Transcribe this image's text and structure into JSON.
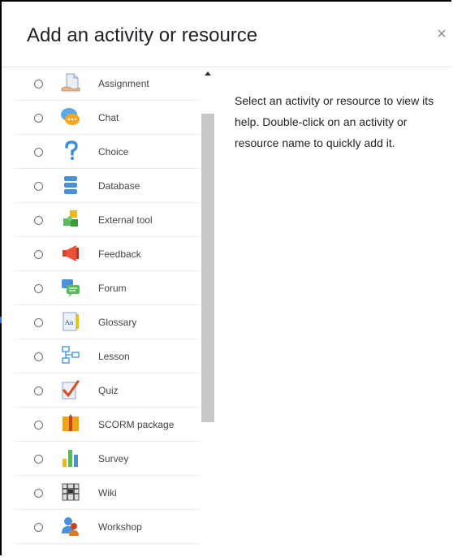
{
  "dialog": {
    "title": "Add an activity or resource",
    "close_symbol": "×"
  },
  "items": [
    {
      "label": "Assignment",
      "icon": "assignment-icon"
    },
    {
      "label": "Chat",
      "icon": "chat-icon"
    },
    {
      "label": "Choice",
      "icon": "choice-icon"
    },
    {
      "label": "Database",
      "icon": "database-icon"
    },
    {
      "label": "External tool",
      "icon": "external-tool-icon"
    },
    {
      "label": "Feedback",
      "icon": "feedback-icon"
    },
    {
      "label": "Forum",
      "icon": "forum-icon"
    },
    {
      "label": "Glossary",
      "icon": "glossary-icon"
    },
    {
      "label": "Lesson",
      "icon": "lesson-icon"
    },
    {
      "label": "Quiz",
      "icon": "quiz-icon"
    },
    {
      "label": "SCORM package",
      "icon": "scorm-package-icon"
    },
    {
      "label": "Survey",
      "icon": "survey-icon"
    },
    {
      "label": "Wiki",
      "icon": "wiki-icon"
    },
    {
      "label": "Workshop",
      "icon": "workshop-icon"
    }
  ],
  "help": {
    "text": "Select an activity or resource to view its help. Double-click on an activity or resource name to quickly add it."
  },
  "colors": {
    "title": "#1d2125",
    "label": "#444444",
    "scroll_thumb": "#c8c8c8"
  }
}
